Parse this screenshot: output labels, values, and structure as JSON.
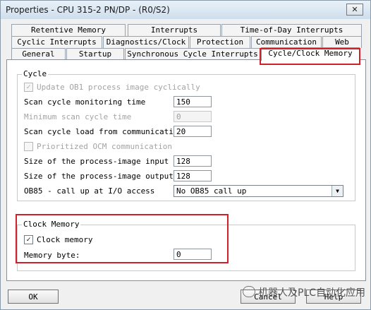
{
  "window": {
    "title": "Properties - CPU 315-2 PN/DP - (R0/S2)",
    "close_label": "✕"
  },
  "tabs": {
    "row1": [
      "Retentive Memory",
      "Interrupts",
      "Time-of-Day Interrupts"
    ],
    "row2": [
      "Cyclic Interrupts",
      "Diagnostics/Clock",
      "Protection",
      "Communication",
      "Web"
    ],
    "row3": [
      "General",
      "Startup",
      "Synchronous Cycle Interrupts",
      "Cycle/Clock Memory"
    ],
    "active": "Cycle/Clock Memory"
  },
  "cycle": {
    "title": "Cycle",
    "update_ob1": {
      "label": "Update OB1 process image cyclically",
      "checked": true,
      "enabled": false
    },
    "scan_monitoring": {
      "label": "Scan cycle monitoring time",
      "value": "150"
    },
    "min_scan": {
      "label": "Minimum scan cycle time",
      "value": "0"
    },
    "scan_load": {
      "label": "Scan cycle load from communication",
      "value": "20"
    },
    "prioritized_ocm": {
      "label": "Prioritized OCM communication",
      "checked": false,
      "enabled": false
    },
    "pi_input": {
      "label": "Size of the process-image input",
      "value": "128"
    },
    "pi_output": {
      "label": "Size of the process-image output",
      "value": "128"
    },
    "ob85": {
      "label": "OB85 - call up at I/O access",
      "value": "No OB85 call up"
    }
  },
  "clock_memory": {
    "title": "Clock Memory",
    "clock_memory_cb": {
      "label": "Clock memory",
      "checked": true
    },
    "memory_byte": {
      "label": "Memory byte:",
      "value": "0"
    }
  },
  "buttons": {
    "ok": "OK",
    "cancel": "Cancel",
    "help": "Help"
  },
  "watermark": {
    "text": "机器人及PLC自动化应用"
  }
}
